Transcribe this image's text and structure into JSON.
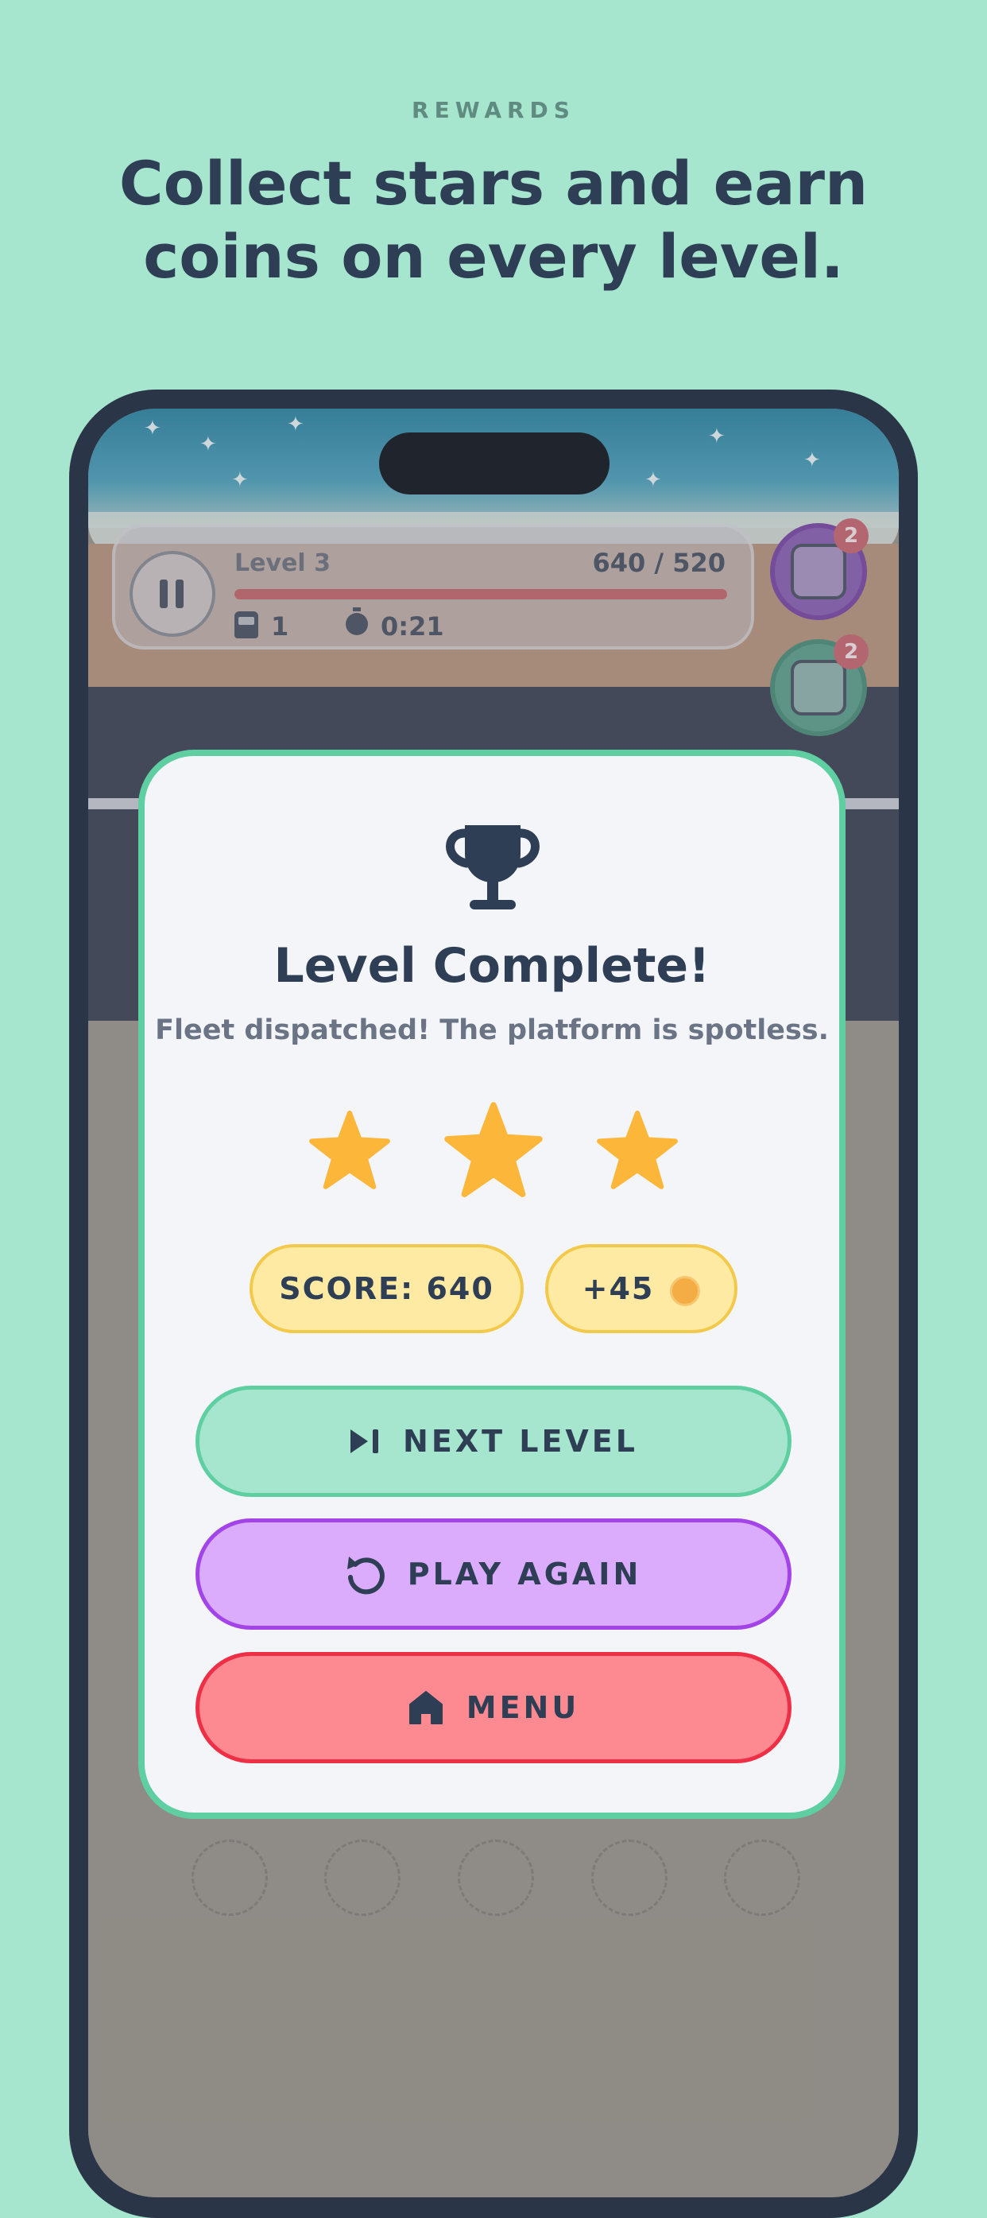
{
  "header": {
    "kicker": "REWARDS",
    "title_line1": "Collect stars and earn",
    "title_line2": "coins on every level."
  },
  "hud": {
    "level_label": "Level 3",
    "score": "640 / 520",
    "buses": "1",
    "timer": "0:21",
    "powerups": [
      {
        "icon": "magnet-powerup-icon",
        "badge": "2"
      },
      {
        "icon": "shuffle-powerup-icon",
        "badge": "2"
      }
    ]
  },
  "modal": {
    "icon": "trophy-icon",
    "title": "Level Complete!",
    "subtitle": "Fleet dispatched! The platform is spotless.",
    "stars_earned": 3,
    "stars_total": 3,
    "score_label": "SCORE: 640",
    "coins_label": "+45",
    "buttons": {
      "next": "NEXT LEVEL",
      "again": "PLAY AGAIN",
      "menu": "MENU"
    }
  },
  "colors": {
    "background": "#a6e6cf",
    "text_dark": "#2e3e55",
    "star": "#fcb63a",
    "next_fill": "#a6e6cf",
    "again_fill": "#dbabfc",
    "menu_fill": "#fe8a91"
  }
}
